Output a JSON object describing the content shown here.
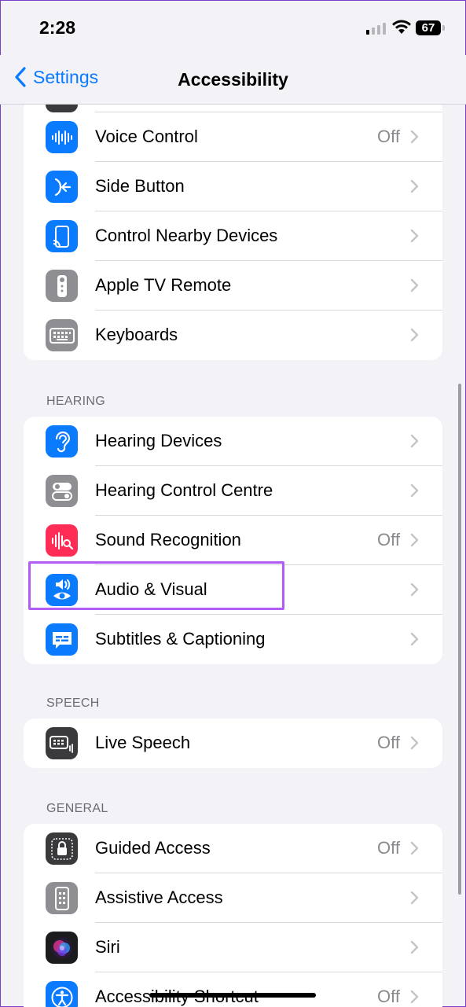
{
  "status_bar": {
    "time": "2:28",
    "battery": "67"
  },
  "nav": {
    "back_label": "Settings",
    "title": "Accessibility"
  },
  "sections": {
    "interaction": {
      "items": [
        {
          "label": "Voice Control",
          "value": "Off",
          "icon": "voice-control-icon",
          "color": "#0a7aff"
        },
        {
          "label": "Side Button",
          "value": "",
          "icon": "side-button-icon",
          "color": "#0a7aff"
        },
        {
          "label": "Control Nearby Devices",
          "value": "",
          "icon": "nearby-devices-icon",
          "color": "#0a7aff"
        },
        {
          "label": "Apple TV Remote",
          "value": "",
          "icon": "tv-remote-icon",
          "color": "#8e8e93"
        },
        {
          "label": "Keyboards",
          "value": "",
          "icon": "keyboard-icon",
          "color": "#8e8e93"
        }
      ]
    },
    "hearing": {
      "header": "HEARING",
      "items": [
        {
          "label": "Hearing Devices",
          "value": "",
          "icon": "ear-icon",
          "color": "#0a7aff"
        },
        {
          "label": "Hearing Control Centre",
          "value": "",
          "icon": "toggles-icon",
          "color": "#8e8e93"
        },
        {
          "label": "Sound Recognition",
          "value": "Off",
          "icon": "sound-recognition-icon",
          "color": "#ff2d55"
        },
        {
          "label": "Audio & Visual",
          "value": "",
          "icon": "audio-visual-icon",
          "color": "#0a7aff"
        },
        {
          "label": "Subtitles & Captioning",
          "value": "",
          "icon": "captions-icon",
          "color": "#0a7aff"
        }
      ]
    },
    "speech": {
      "header": "SPEECH",
      "items": [
        {
          "label": "Live Speech",
          "value": "Off",
          "icon": "live-speech-icon",
          "color": "#3a3a3c"
        }
      ]
    },
    "general": {
      "header": "GENERAL",
      "items": [
        {
          "label": "Guided Access",
          "value": "Off",
          "icon": "lock-icon",
          "color": "#3a3a3c"
        },
        {
          "label": "Assistive Access",
          "value": "",
          "icon": "assistive-access-icon",
          "color": "#8e8e93"
        },
        {
          "label": "Siri",
          "value": "",
          "icon": "siri-icon",
          "color": "#1c1c1e"
        },
        {
          "label": "Accessibility Shortcut",
          "value": "Off",
          "icon": "accessibility-icon",
          "color": "#0a7aff"
        }
      ]
    }
  }
}
